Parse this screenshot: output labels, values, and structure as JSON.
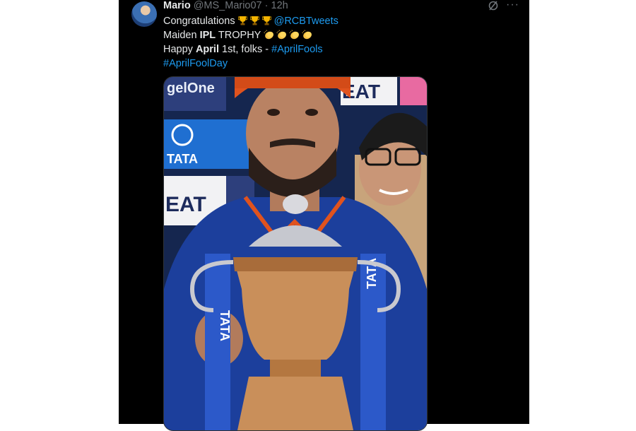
{
  "tweet": {
    "author_name": "Mario",
    "author_handle": "@MS_Mario07",
    "separator": "·",
    "time": "12h",
    "line1_text": "Congratulations ",
    "line1_mention": "@RCBTweets",
    "line2_prefix": "Maiden ",
    "line2_bold": "IPL",
    "line2_suffix": " TROPHY ",
    "line3_prefix": "Happy ",
    "line3_bold": "April",
    "line3_middle": " 1st, folks - ",
    "line3_hashtag": "#AprilFools",
    "line4_hashtag": "#AprilFoolDay",
    "more_label": "···"
  },
  "media": {
    "banner_logo_1": "gelOne",
    "banner_logo_2": "EAT",
    "banner_tata": "TATA",
    "ribbon_text": "TATA"
  },
  "colors": {
    "background": "#000000",
    "text": "#e7e9ea",
    "secondary": "#71767b",
    "link": "#1d9bf0",
    "jersey": "#1c3f9c",
    "cap": "#e0531e",
    "trophy": "#c98f5a"
  },
  "icons": [
    "grok-icon",
    "more-icon",
    "trophy-emoji",
    "clap-emoji"
  ]
}
